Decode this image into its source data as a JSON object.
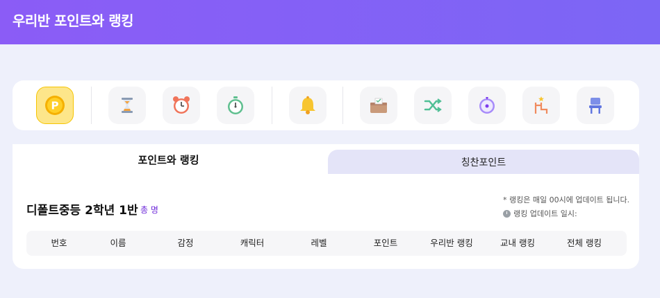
{
  "header": {
    "title": "우리반 포인트와 랭킹"
  },
  "toolbar": {
    "items": [
      {
        "name": "point-coin-icon",
        "active": true
      },
      {
        "name": "hourglass-icon"
      },
      {
        "name": "alarm-clock-icon"
      },
      {
        "name": "stopwatch-icon"
      },
      {
        "name": "bell-icon"
      },
      {
        "name": "ballot-box-icon"
      },
      {
        "name": "shuffle-icon"
      },
      {
        "name": "roulette-icon"
      },
      {
        "name": "ladder-icon"
      },
      {
        "name": "chair-icon"
      }
    ]
  },
  "tabs": {
    "active": "포인트와 랭킹",
    "inactive": "칭찬포인트"
  },
  "class": {
    "title": "디폴트중등 2학년 1반",
    "total_label": "총 명"
  },
  "notes": {
    "update_notice": "* 랭킹은 매일 00시에 업데이트 됩니다.",
    "update_time_label": "랭킹 업데이트 일시:"
  },
  "table": {
    "columns": [
      "번호",
      "이름",
      "감정",
      "캐릭터",
      "레벨",
      "포인트",
      "우리반 랭킹",
      "교내 랭킹",
      "전체 랭킹"
    ]
  },
  "colors": {
    "header": "#8b5cf6",
    "accent_text": "#6d28d9",
    "background": "#eef0fb"
  }
}
